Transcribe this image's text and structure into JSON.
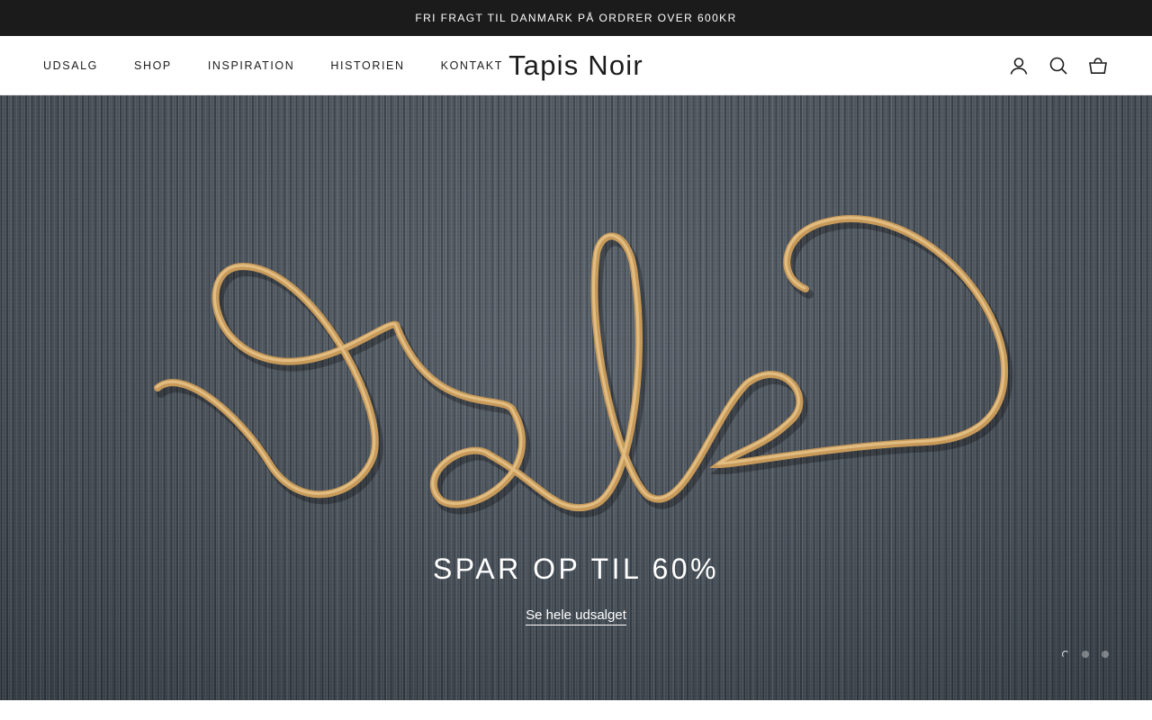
{
  "announcement": {
    "text": "FRI FRAGT TIL DANMARK PÅ ORDRER OVER 600KR"
  },
  "header": {
    "logo": "Tapis Noir",
    "nav": [
      {
        "label": "UDSALG"
      },
      {
        "label": "SHOP"
      },
      {
        "label": "INSPIRATION"
      },
      {
        "label": "HISTORIEN"
      },
      {
        "label": "KONTAKT"
      }
    ],
    "icons": [
      "account-icon",
      "search-icon",
      "cart-icon"
    ]
  },
  "hero": {
    "title": "SPAR OP TIL 60%",
    "link_label": "Se hele udsalget",
    "slides_total": 3,
    "active_slide": 1
  },
  "colors": {
    "announcement_bg": "#1b1b1b",
    "header_bg": "#ffffff",
    "hero_fabric": "#4f5863",
    "ribbon": "#c79a5a",
    "hero_text": "#ffffff"
  }
}
